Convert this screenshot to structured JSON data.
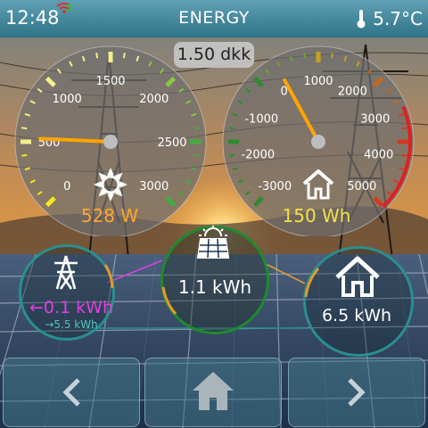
{
  "status_bar": {
    "time": "12:48",
    "title": "ENERGY",
    "temperature": "5.7°C",
    "wifi_icon": "wifi-icon",
    "thermometer_icon": "thermometer-icon"
  },
  "price": "1.50 dkk",
  "solar_gauge": {
    "ticks": [
      "0",
      "500",
      "1000",
      "1500",
      "2000",
      "2500",
      "3000"
    ],
    "value_label": "528 W",
    "needle_value": 528,
    "icon": "sun-icon"
  },
  "home_gauge": {
    "ticks": [
      "-3000",
      "-2000",
      "-1000",
      "0",
      "1000",
      "2000",
      "3000",
      "4000",
      "5000"
    ],
    "value_label": "150 Wh",
    "needle_value": 150,
    "icon": "house-icon"
  },
  "flows": {
    "grid": {
      "value": "←0.1 kWh",
      "sub_value": "→5.5 kWh",
      "icon": "power-pylon-icon"
    },
    "solar": {
      "value": "1.1 kWh",
      "icon": "solar-panel-icon"
    },
    "home": {
      "value": "6.5 kWh",
      "icon": "house-icon"
    }
  },
  "nav": {
    "prev_icon": "chevron-left-icon",
    "home_icon": "home-icon",
    "next_icon": "chevron-right-icon"
  },
  "colors": {
    "status_bar": "#3f8499",
    "solar_value": "#ffa633",
    "home_value": "#f2e14a",
    "grid_value": "#e040e0",
    "grid_sub_value": "#52c3c3",
    "needle": "#ffa500",
    "solar_ring": "#1f8a2e",
    "teal_ring": "#2a8f8f"
  }
}
